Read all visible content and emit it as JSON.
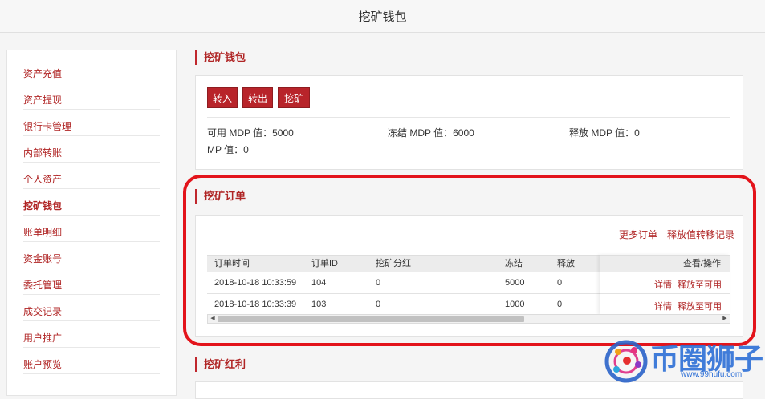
{
  "page": {
    "title": "挖矿钱包"
  },
  "sidebar": {
    "items": [
      {
        "label": "资产充值"
      },
      {
        "label": "资产提现"
      },
      {
        "label": "银行卡管理"
      },
      {
        "label": "内部转账"
      },
      {
        "label": "个人资产"
      },
      {
        "label": "挖矿钱包"
      },
      {
        "label": "账单明细"
      },
      {
        "label": "资金账号"
      },
      {
        "label": "委托管理"
      },
      {
        "label": "成交记录"
      },
      {
        "label": "用户推广"
      },
      {
        "label": "账户预览"
      }
    ],
    "active": "挖矿钱包"
  },
  "wallet": {
    "title": "挖矿钱包",
    "buttons": {
      "transfer_in": "转入",
      "transfer_out": "转出",
      "mine": "挖矿"
    },
    "available": "可用 MDP 值：5000",
    "frozen": "冻结 MDP 值：6000",
    "released": "释放 MDP 值：0",
    "mp": "MP 值：0"
  },
  "orders": {
    "title": "挖矿订单",
    "more_orders": "更多订单",
    "release_transfer_log": "释放值转移记录",
    "columns": [
      "订单时间",
      "订单ID",
      "挖矿分红",
      "冻结",
      "释放",
      "查看/操作"
    ],
    "rows": [
      {
        "time": "2018-10-18 10:33:59",
        "id": "104",
        "dividend": "0",
        "frozen": "5000",
        "released": "0",
        "detail": "详情",
        "release_action": "释放至可用"
      },
      {
        "time": "2018-10-18 10:33:39",
        "id": "103",
        "dividend": "0",
        "frozen": "1000",
        "released": "0",
        "detail": "详情",
        "release_action": "释放至可用"
      }
    ]
  },
  "bonus": {
    "title": "挖矿红利"
  },
  "watermark": {
    "brand": "币圈狮子",
    "url": "www.99hufu.com"
  },
  "colors": {
    "accent": "#b8242a",
    "highlight": "#e3141b"
  }
}
